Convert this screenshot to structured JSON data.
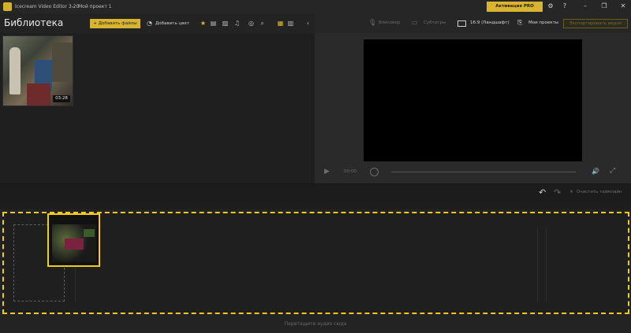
{
  "window": {
    "app_title": "Icecream Video Editor 3.20",
    "separator": "-",
    "project_title": "Мой проект 1",
    "activate_pro": "Активация PRO версии",
    "icons": [
      "gear-icon",
      "help-icon",
      "minimize-icon",
      "maximize-icon",
      "close-icon"
    ]
  },
  "library": {
    "title": "Библиотека",
    "add_files": "+ Добавить файлы",
    "add_color": "Добавить цвет",
    "filter_icons": [
      "star-icon",
      "video-filter-icon",
      "image-filter-icon",
      "audio-filter-icon",
      "color-filter-icon",
      "search-icon",
      "grid-view-icon",
      "list-view-icon",
      "collapse-icon"
    ],
    "items": [
      {
        "duration": "03:28"
      }
    ]
  },
  "preview_toolbar": {
    "voiceover": "Войсовер",
    "subtitles": "Субтитры",
    "aspect_ratio": "16:9 (Ландшафт)",
    "my_projects": "Мои проекты",
    "export": "Экспортировать видео"
  },
  "player": {
    "time": "00:00"
  },
  "timeline": {
    "clear": "Очистить таймлайн",
    "drop_audio": "Перетащите аудио сюда"
  },
  "colors": {
    "accent": "#f2cc1d",
    "background": "#1e1e1e"
  }
}
